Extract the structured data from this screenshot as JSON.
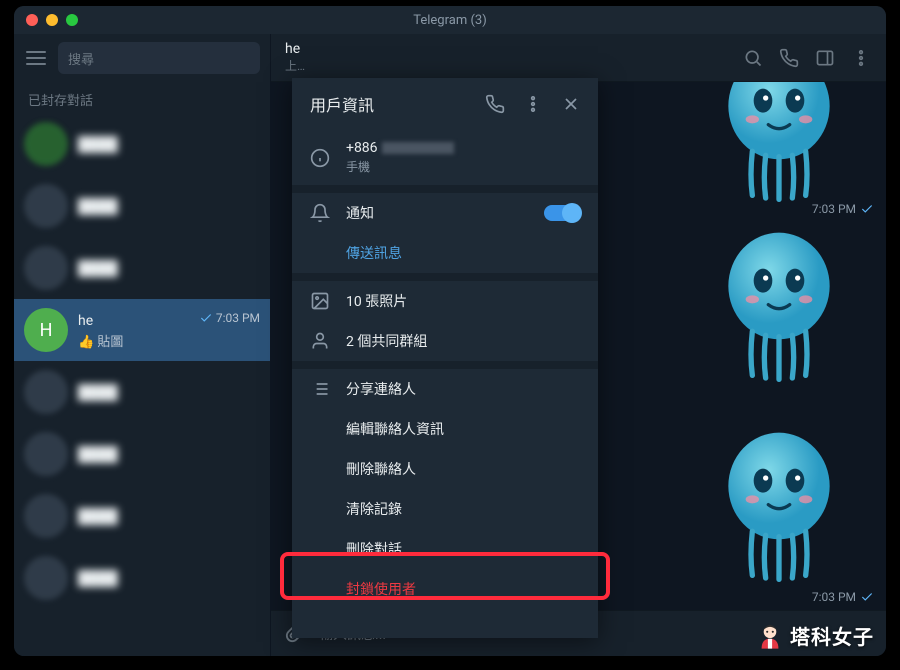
{
  "titlebar": {
    "title": "Telegram (3)"
  },
  "sidebar": {
    "search_placeholder": "搜尋",
    "saved_label": "已封存對話",
    "active_chat": {
      "initial": "H",
      "name": "he",
      "time": "7:03 PM",
      "preview": "👍 貼圖"
    }
  },
  "chat_header": {
    "name": "he",
    "subtitle": "上…"
  },
  "messages": {
    "t1": "7:03 PM",
    "t2": "7:03 PM"
  },
  "composer": {
    "placeholder": "輸入訊息..."
  },
  "panel": {
    "title": "用戶資訊",
    "phone_prefix": "+886",
    "phone_label": "手機",
    "notify": "通知",
    "send_msg": "傳送訊息",
    "photos": "10 張照片",
    "groups": "2 個共同群組",
    "share": "分享連絡人",
    "edit": "編輯聯絡人資訊",
    "delete_contact": "刪除聯絡人",
    "clear": "清除記錄",
    "delete_chat": "刪除對話",
    "block": "封鎖使用者"
  },
  "watermark": "塔科女子"
}
